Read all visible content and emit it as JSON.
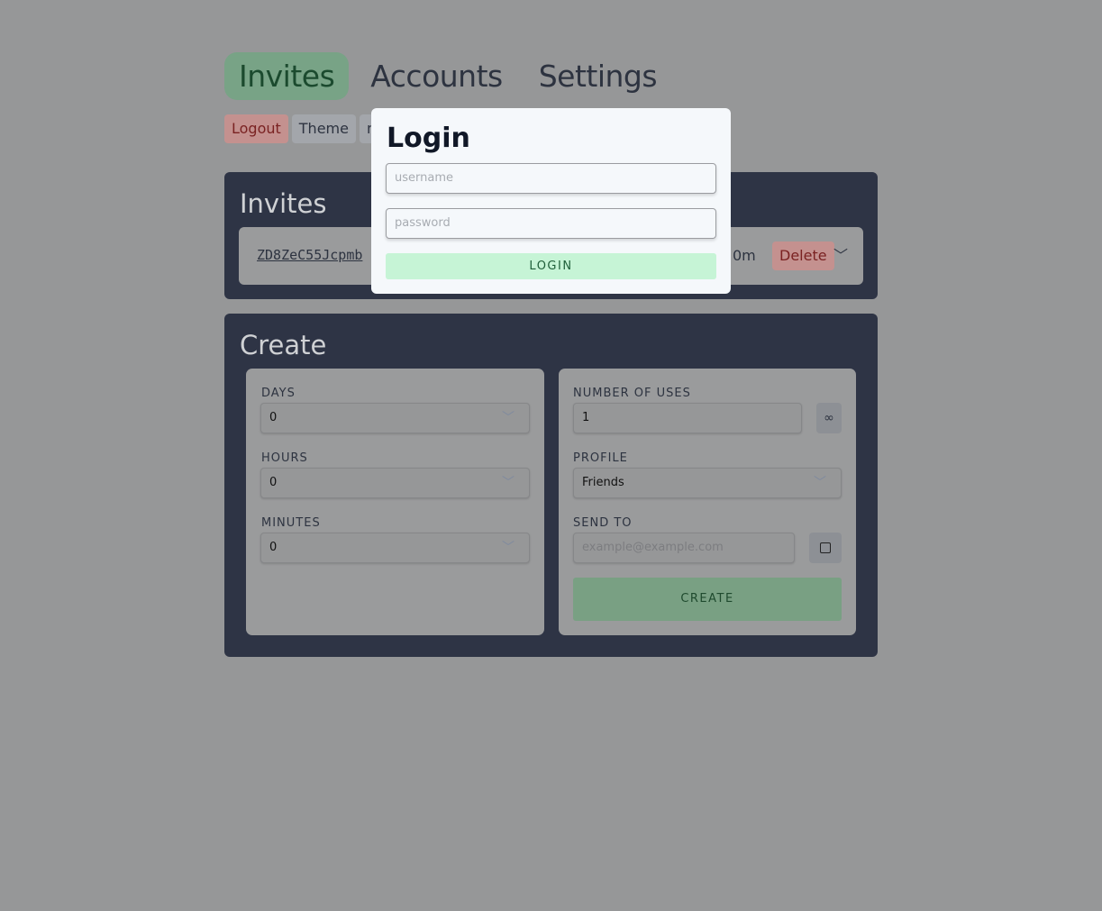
{
  "nav": {
    "tabs": [
      {
        "label": "Invites",
        "active": true
      },
      {
        "label": "Accounts"
      },
      {
        "label": "Settings"
      }
    ]
  },
  "toolbar": {
    "logout": "Logout",
    "theme": "Theme",
    "partial": "m"
  },
  "invites": {
    "title": "Invites",
    "code": "ZD8ZeC55Jcpmb",
    "expiry_partial": "0m",
    "delete": "Delete"
  },
  "create": {
    "title": "Create",
    "days": {
      "label": "DAYS",
      "value": "0"
    },
    "hours": {
      "label": "HOURS",
      "value": "0"
    },
    "minutes": {
      "label": "MINUTES",
      "value": "0"
    },
    "uses": {
      "label": "NUMBER OF USES",
      "value": "1",
      "infinity": "∞"
    },
    "profile": {
      "label": "PROFILE",
      "value": "Friends"
    },
    "send_to": {
      "label": "SEND TO",
      "placeholder": "example@example.com"
    },
    "button": "CREATE"
  },
  "login": {
    "title": "Login",
    "username_placeholder": "username",
    "password_placeholder": "password",
    "button": "LOGIN"
  },
  "colors": {
    "accent": "#c6f4d6",
    "danger": "#c4918f",
    "card": "#2e3445"
  }
}
